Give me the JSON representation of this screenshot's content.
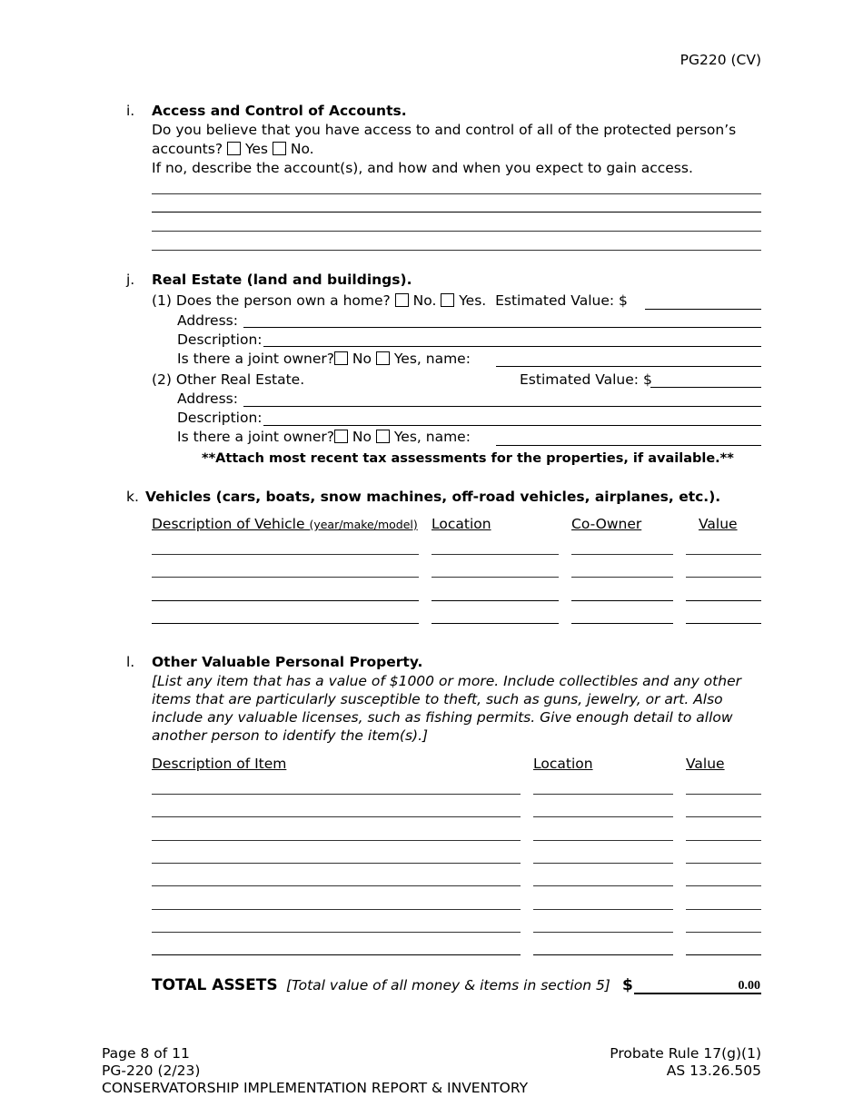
{
  "header": {
    "form_code": "PG220 (CV)"
  },
  "section_i": {
    "letter": "i.",
    "title": "Access and Control of Accounts.",
    "question_line1": "Do you believe that you have access to and control of all of the protected person’s",
    "question_line2": "accounts?",
    "yes_label": "Yes",
    "no_label": "No.",
    "instruction": "If no, describe the account(s), and how and when you expect to gain access."
  },
  "section_j": {
    "letter": "j.",
    "title": "Real Estate (land and buildings).",
    "home": {
      "question": "(1) Does the person own a home?",
      "no_label": "No.",
      "yes_label": "Yes.",
      "value_label": "Estimated Value: $",
      "address_label": "Address:",
      "description_label": "Description:",
      "joint_label": "Is there a joint owner?",
      "joint_no": "No",
      "joint_yes": "Yes, name:"
    },
    "other": {
      "question": "(2) Other Real Estate.",
      "value_label": "Estimated Value: $",
      "address_label": "Address:",
      "description_label": "Description:",
      "joint_label": "Is there a joint owner?",
      "joint_no": "No",
      "joint_yes": "Yes, name:"
    },
    "note": "**Attach most recent tax assessments for the properties, if available.**"
  },
  "section_k": {
    "letter": "k.",
    "title": "Vehicles (cars, boats, snow machines, off-road vehicles, airplanes, etc.).",
    "columns": {
      "description": "Description of Vehicle",
      "description_sub": "(year/make/model)",
      "location": "Location",
      "coowner": "Co-Owner",
      "value": "Value"
    },
    "row_count": 4
  },
  "section_l": {
    "letter": "l.",
    "title": "Other Valuable Personal Property.",
    "instructions": [
      "[List any item that has a value of $1000 or more.  Include collectibles and any other",
      "items that are particularly susceptible to theft, such as guns, jewelry, or art.  Also",
      "include any valuable licenses, such as fishing permits.  Give enough detail to allow",
      "another person to identify the item(s).]"
    ],
    "columns": {
      "description": "Description of Item",
      "location": "Location",
      "value": "Value"
    },
    "row_count": 8
  },
  "total": {
    "label": "TOTAL ASSETS",
    "note": "[Total value of all money & items in section 5]",
    "currency": "$",
    "value": "0.00"
  },
  "footer": {
    "page": "Page 8 of 11",
    "form_version": "PG-220 (2/23)",
    "form_title": "CONSERVATORSHIP IMPLEMENTATION REPORT & INVENTORY",
    "rule": "Probate Rule 17(g)(1)",
    "statute": "AS 13.26.505"
  }
}
